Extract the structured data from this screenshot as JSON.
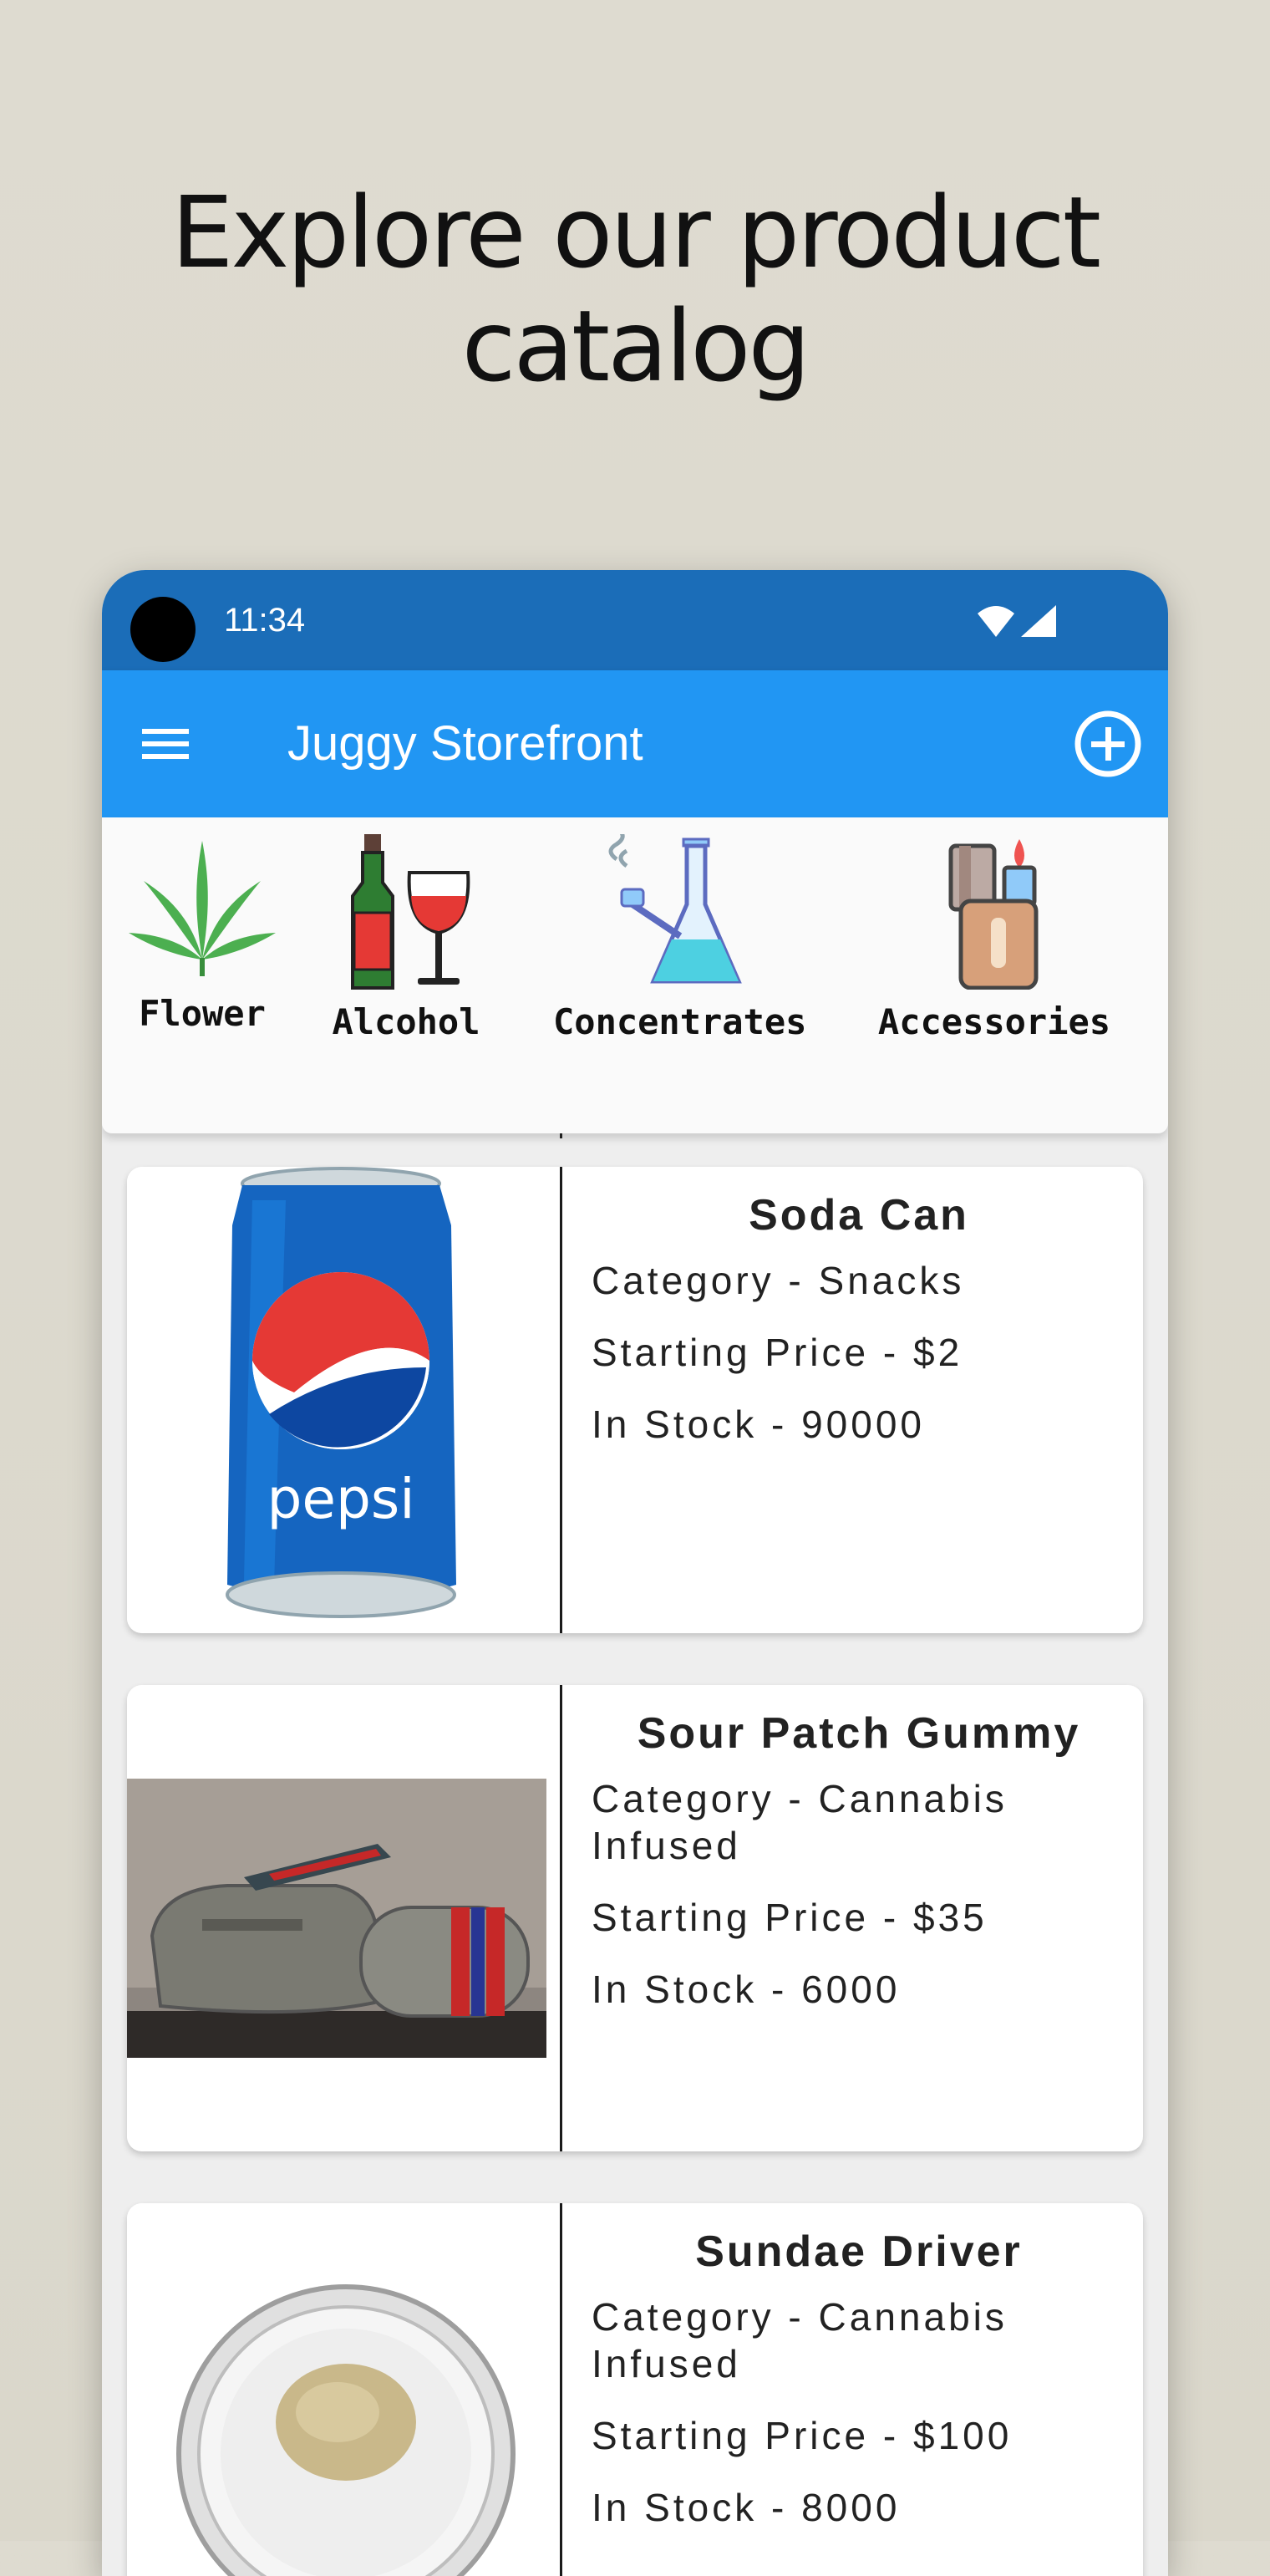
{
  "headline": {
    "line1": "Explore our product",
    "line2": "catalog"
  },
  "status_bar": {
    "time": "11:34",
    "wifi_icon": "wifi-icon",
    "signal_icon": "signal-icon"
  },
  "app_bar": {
    "title": "Juggy Storefront",
    "menu_icon": "hamburger-menu-icon",
    "add_icon": "add-circle-icon"
  },
  "categories": [
    {
      "label": "Flower",
      "icon": "cannabis-leaf-icon"
    },
    {
      "label": "Alcohol",
      "icon": "wine-bottle-glass-icon"
    },
    {
      "label": "Concentrates",
      "icon": "bong-icon"
    },
    {
      "label": "Accessories",
      "icon": "lighter-icon"
    }
  ],
  "products": [
    {
      "name": "Soda Can",
      "category": "Category - Snacks",
      "price": "Starting Price - $2",
      "stock": "In Stock - 90000",
      "image": "pepsi-can-image",
      "image_text": "pepsi"
    },
    {
      "name": "Sour Patch Gummy",
      "category": "Category - Cannabis Infused",
      "price": "Starting Price - $35",
      "stock": "In Stock - 6000",
      "image": "designer-bags-image"
    },
    {
      "name": "Sundae Driver",
      "category": "Category - Cannabis Infused",
      "price": "Starting Price - $100",
      "stock": "In Stock - 8000",
      "image": "concentrate-jar-image"
    }
  ],
  "colors": {
    "status_bar": "#1b6db8",
    "app_bar": "#2196f3",
    "background": "#dedbd0"
  }
}
